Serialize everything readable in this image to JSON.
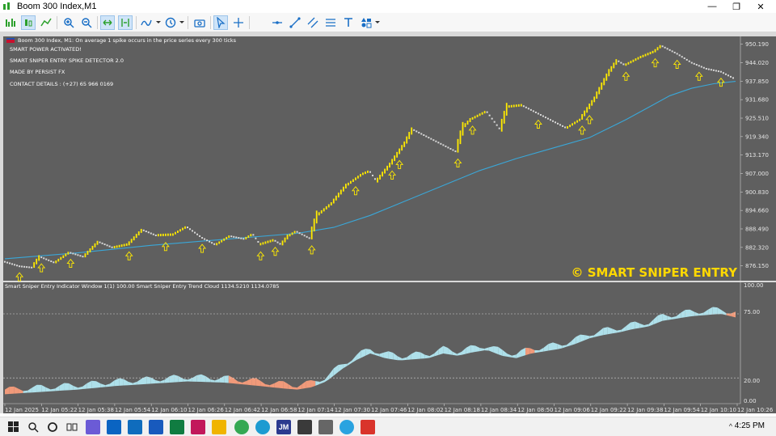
{
  "window": {
    "title": "Boom 300 Index,M1",
    "controls": {
      "minimize": "—",
      "restore": "❐",
      "close": "✕"
    }
  },
  "toolbar": {
    "icons": [
      "new-order-icon",
      "candlestick-icon",
      "line-chart-icon",
      "zoom-in-icon",
      "zoom-out-icon",
      "autoscroll-icon",
      "chart-shift-icon",
      "indicators-icon",
      "periods-icon",
      "screenshot-icon",
      "cursor-icon",
      "crosshair-icon",
      "horizontal-line-icon",
      "trend-line-icon",
      "channel-icon",
      "fibonacci-icon",
      "text-icon",
      "shapes-icon"
    ]
  },
  "chart": {
    "header": "Boom 300 Index, M1:  On average 1 spike occurs in the price series every 300 ticks",
    "info_lines": [
      "SMART POWER ACTIVATED!",
      "SMART SNIPER ENTRY SPIKE DETECTOR 2.0",
      "MADE BY PERSIST FX",
      "CONTACT DETAILS : (+27) 65 966 0169"
    ],
    "watermark": "© SMART SNIPER ENTRY",
    "colors": {
      "background": "#5f5f5f",
      "bull": "#ffea00",
      "bear": "#d9d9d9",
      "ma": "#3aa7d8",
      "cloud_up": "#aee0ea",
      "cloud_down": "#f19a7a"
    }
  },
  "indicator": {
    "header": "Smart Sniper Entry Indicator Window 1(1) 100.00 Smart Sniper Entry Trend Cloud 1134.5210 1134.0785",
    "levels": [
      "100.00",
      "75.00",
      "20.00",
      "0.00"
    ]
  },
  "chart_data": {
    "type": "line",
    "title": "Boom 300 Index, M1",
    "y_ticks": [
      "950.190",
      "944.020",
      "937.850",
      "931.680",
      "925.510",
      "919.340",
      "913.170",
      "907.000",
      "900.830",
      "894.660",
      "888.490",
      "882.320",
      "876.150"
    ],
    "ylim": [
      872.0,
      952.0
    ],
    "x_ticks": [
      "12 Jan 2025",
      "12 Jan 05:22",
      "12 Jan 05:38",
      "12 Jan 05:54",
      "12 Jan 06:10",
      "12 Jan 06:26",
      "12 Jan 06:42",
      "12 Jan 06:58",
      "12 Jan 07:14",
      "12 Jan 07:30",
      "12 Jan 07:46",
      "12 Jan 08:02",
      "12 Jan 08:18",
      "12 Jan 08:34",
      "12 Jan 08:50",
      "12 Jan 09:06",
      "12 Jan 09:22",
      "12 Jan 09:38",
      "12 Jan 09:54",
      "12 Jan 10:10",
      "12 Jan 10:26"
    ],
    "price_path": [
      [
        0,
        877.5
      ],
      [
        2,
        876.0
      ],
      [
        4,
        875.5
      ],
      [
        5,
        879
      ],
      [
        7,
        877
      ],
      [
        9,
        880.5
      ],
      [
        11,
        879
      ],
      [
        13,
        884
      ],
      [
        15,
        882
      ],
      [
        17,
        883
      ],
      [
        19,
        888
      ],
      [
        21,
        886
      ],
      [
        23,
        886.2
      ],
      [
        25,
        889
      ],
      [
        27,
        885.5
      ],
      [
        29,
        883
      ],
      [
        31,
        886
      ],
      [
        33,
        885
      ],
      [
        34,
        886.5
      ],
      [
        35,
        883
      ],
      [
        37,
        884.5
      ],
      [
        38,
        883
      ],
      [
        39,
        886
      ],
      [
        40,
        887.5
      ],
      [
        42,
        885
      ],
      [
        43,
        893
      ],
      [
        45,
        897
      ],
      [
        47,
        903
      ],
      [
        49,
        906.5
      ],
      [
        50,
        907.5
      ],
      [
        51,
        904
      ],
      [
        53,
        910
      ],
      [
        55,
        917
      ],
      [
        56,
        921.5
      ],
      [
        58,
        919
      ],
      [
        62,
        914
      ],
      [
        63,
        922.5
      ],
      [
        64,
        925
      ],
      [
        66,
        927.5
      ],
      [
        68,
        921
      ],
      [
        69,
        929
      ],
      [
        71,
        929.5
      ],
      [
        73,
        927
      ],
      [
        77,
        922
      ],
      [
        79,
        925
      ],
      [
        81,
        932
      ],
      [
        83,
        941
      ],
      [
        84,
        944.5
      ],
      [
        85,
        943
      ],
      [
        87,
        945.5
      ],
      [
        89,
        947.5
      ],
      [
        90,
        949.5
      ],
      [
        92,
        947
      ],
      [
        94,
        944
      ],
      [
        96,
        942
      ],
      [
        98,
        941
      ],
      [
        100,
        938.5
      ]
    ],
    "ma_path": [
      [
        0,
        878.5
      ],
      [
        10,
        880.5
      ],
      [
        20,
        883
      ],
      [
        30,
        885
      ],
      [
        40,
        887
      ],
      [
        45,
        889
      ],
      [
        50,
        893
      ],
      [
        55,
        898
      ],
      [
        60,
        903
      ],
      [
        65,
        908
      ],
      [
        70,
        912
      ],
      [
        75,
        915.5
      ],
      [
        80,
        919
      ],
      [
        85,
        925
      ],
      [
        88,
        929
      ],
      [
        91,
        933
      ],
      [
        94,
        935.5
      ],
      [
        97,
        937
      ],
      [
        100,
        937.8
      ]
    ],
    "oscillator_path": [
      [
        0,
        7
      ],
      [
        5,
        9
      ],
      [
        10,
        11
      ],
      [
        15,
        14
      ],
      [
        20,
        16
      ],
      [
        25,
        18
      ],
      [
        30,
        17
      ],
      [
        35,
        14
      ],
      [
        38,
        12
      ],
      [
        40,
        11
      ],
      [
        42,
        13
      ],
      [
        44,
        18
      ],
      [
        46,
        28
      ],
      [
        48,
        36
      ],
      [
        50,
        42
      ],
      [
        52,
        38
      ],
      [
        54,
        36
      ],
      [
        56,
        37
      ],
      [
        58,
        38
      ],
      [
        60,
        42
      ],
      [
        62,
        40
      ],
      [
        64,
        43
      ],
      [
        66,
        45
      ],
      [
        68,
        40
      ],
      [
        70,
        38
      ],
      [
        72,
        42
      ],
      [
        74,
        44
      ],
      [
        76,
        46
      ],
      [
        78,
        50
      ],
      [
        80,
        55
      ],
      [
        82,
        58
      ],
      [
        84,
        60
      ],
      [
        86,
        63
      ],
      [
        88,
        65
      ],
      [
        90,
        70
      ],
      [
        92,
        72
      ],
      [
        94,
        74
      ],
      [
        96,
        75
      ],
      [
        98,
        76
      ],
      [
        100,
        73
      ]
    ]
  },
  "taskbar": {
    "time": "4:25 PM",
    "apps": [
      "start-icon",
      "search-icon",
      "cortana-icon",
      "task-view-icon",
      "copilot-icon",
      "mail-icon",
      "outlook-icon",
      "word-icon",
      "excel-icon",
      "onenote-icon",
      "media-icon",
      "photos-icon",
      "chrome-icon",
      "edge-icon",
      "teams-icon",
      "mt5-icon",
      "store-icon",
      "settings-icon",
      "telegram-icon",
      "maps-icon"
    ]
  }
}
